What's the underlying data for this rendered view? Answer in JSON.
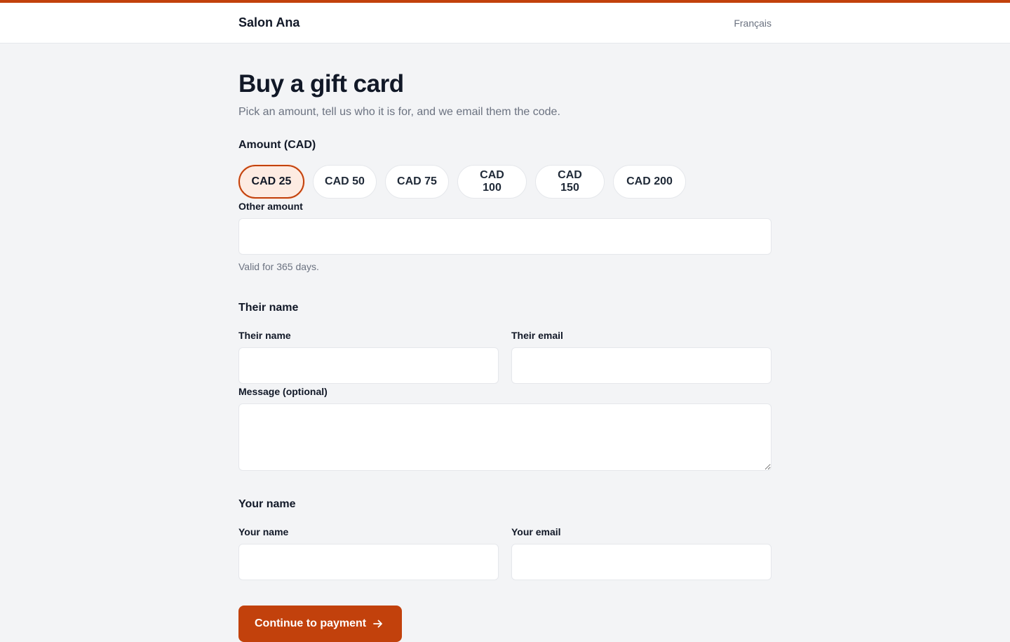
{
  "header": {
    "brand": "Salon Ana",
    "language_link": "Français"
  },
  "page": {
    "title": "Buy a gift card",
    "subtitle": "Pick an amount, tell us who it is for, and we email them the code."
  },
  "amount": {
    "label": "Amount (CAD)",
    "options": [
      "CAD 25",
      "CAD 50",
      "CAD 75",
      "CAD 100",
      "CAD 150",
      "CAD 200"
    ],
    "selected": "CAD 25",
    "other_label": "Other amount",
    "other_value": "",
    "validity_hint": "Valid for 365 days."
  },
  "recipient": {
    "heading": "Their name",
    "name_label": "Their name",
    "name_value": "",
    "email_label": "Their email",
    "email_value": "",
    "message_label": "Message (optional)",
    "message_value": ""
  },
  "sender": {
    "heading": "Your name",
    "name_label": "Your name",
    "name_value": "",
    "email_label": "Your email",
    "email_value": ""
  },
  "actions": {
    "continue_label": "Continue to payment",
    "continue_icon": "arrow-right-icon"
  },
  "colors": {
    "accent": "#c2410c",
    "selected_bg": "#fdebe2",
    "background": "#f3f4f6"
  }
}
